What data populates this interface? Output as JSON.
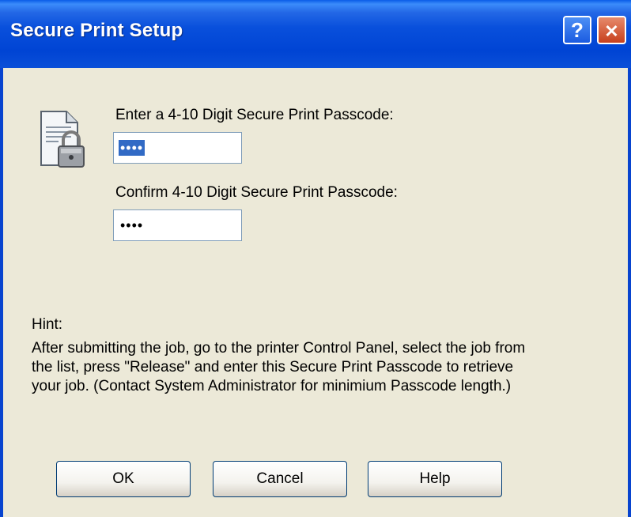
{
  "window": {
    "title": "Secure Print Setup",
    "help_glyph": "?",
    "close_glyph": "✕"
  },
  "icon": "document-padlock-icon",
  "passcode": {
    "label": "Enter a 4-10 Digit Secure Print Passcode:",
    "value": "••••"
  },
  "confirm": {
    "label": "Confirm 4-10 Digit Secure Print Passcode:",
    "value": "••••"
  },
  "hint": {
    "heading": "Hint:",
    "text": "After submitting the job, go to the printer Control Panel, select the job from the list, press \"Release\" and enter this Secure Print Passcode to retrieve your job. (Contact System Administrator for minimium Passcode length.)"
  },
  "buttons": {
    "ok": "OK",
    "cancel": "Cancel",
    "help": "Help"
  }
}
